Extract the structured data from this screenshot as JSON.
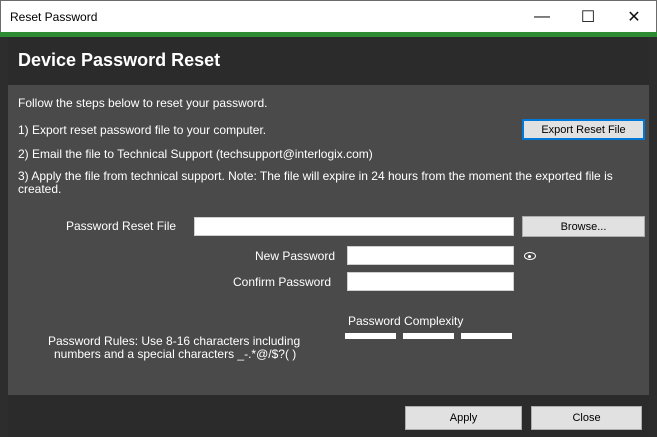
{
  "window": {
    "title": "Reset Password",
    "minimize": "—",
    "maximize": "☐",
    "close": "✕"
  },
  "header": {
    "title": "Device Password Reset"
  },
  "instructions": {
    "intro": "Follow the steps below to reset your password.",
    "step1": "1)  Export reset password file to your computer.",
    "step2": "2)  Email the file to Technical Support (techsupport@interlogix.com)",
    "step3_line1": "3) Apply the file from technical support. Note:  The file will expire in 24 hours from the moment the exported file is",
    "step3_line2": "created."
  },
  "buttons": {
    "export": "Export Reset File",
    "browse": "Browse...",
    "apply": "Apply",
    "close": "Close"
  },
  "form": {
    "reset_file_label": "Password Reset File",
    "new_password_label": "New Password",
    "confirm_password_label": "Confirm Password",
    "reset_file_value": "",
    "new_password_value": "",
    "confirm_password_value": ""
  },
  "rules": {
    "line1": "Password Rules: Use 8-16 characters including",
    "line2": "numbers and a special characters  _-.*@/$?( )",
    "complexity_label": "Password Complexity"
  },
  "colors": {
    "accent": "#2e8b34",
    "panel": "#4a4a4a",
    "header": "#2b2b2b",
    "focus": "#0078d7"
  }
}
